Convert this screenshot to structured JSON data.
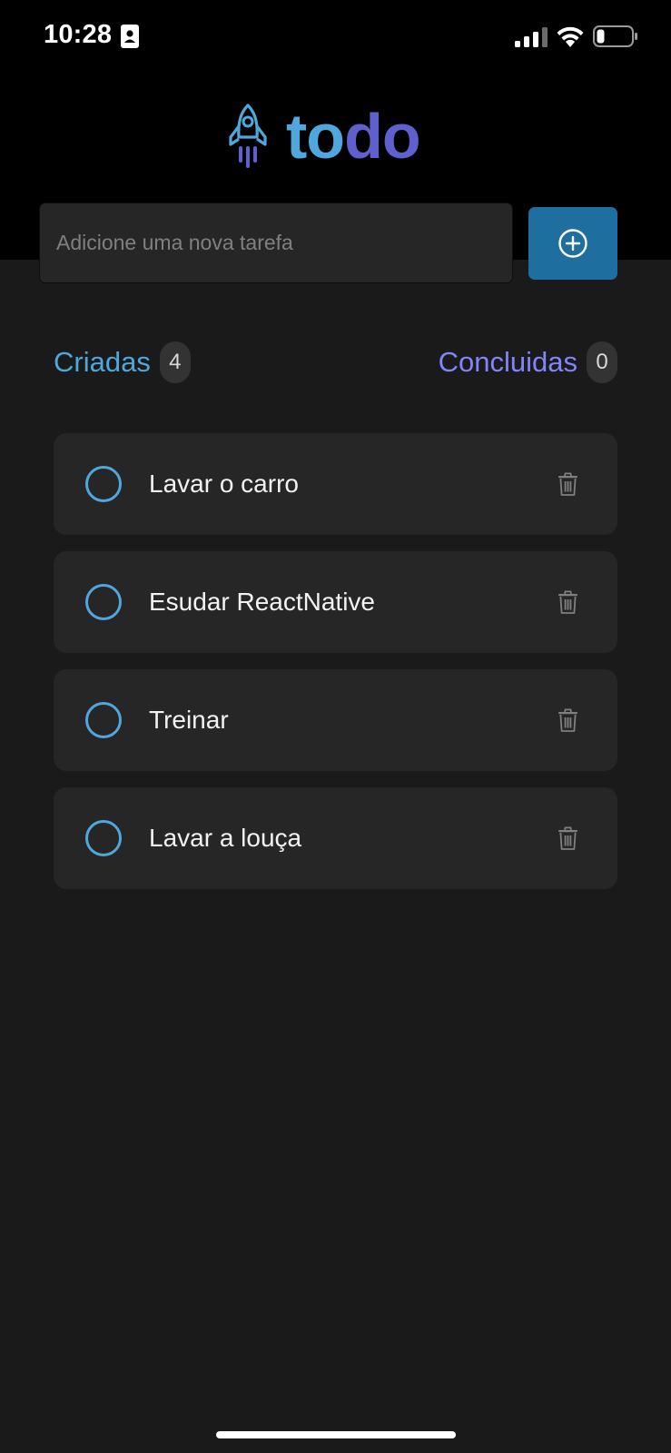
{
  "status_bar": {
    "time": "10:28",
    "icons": [
      "contact-card-icon",
      "signal-icon",
      "wifi-icon",
      "battery-icon"
    ]
  },
  "logo": {
    "icon": "rocket-icon",
    "text_part_1": "to",
    "text_part_2": "do",
    "colors": {
      "to": "#4ea8de",
      "do": "#5e60ce"
    }
  },
  "new_task": {
    "placeholder": "Adicione uma nova tarefa",
    "value": "",
    "add_button_icon": "plus-circle-icon"
  },
  "counters": {
    "created_label": "Criadas",
    "created_count": "4",
    "done_label": "Concluidas",
    "done_count": "0"
  },
  "tasks": [
    {
      "text": "Lavar o carro",
      "done": false
    },
    {
      "text": "Esudar ReactNative",
      "done": false
    },
    {
      "text": "Treinar",
      "done": false
    },
    {
      "text": "Lavar a louça",
      "done": false
    }
  ],
  "colors": {
    "background": "#1a1a1a",
    "header": "#000000",
    "card": "#262626",
    "blue": "#4ea8de",
    "blue_dark": "#1e6f9f",
    "purple": "#5e60ce",
    "purple_light": "#8284fa"
  }
}
